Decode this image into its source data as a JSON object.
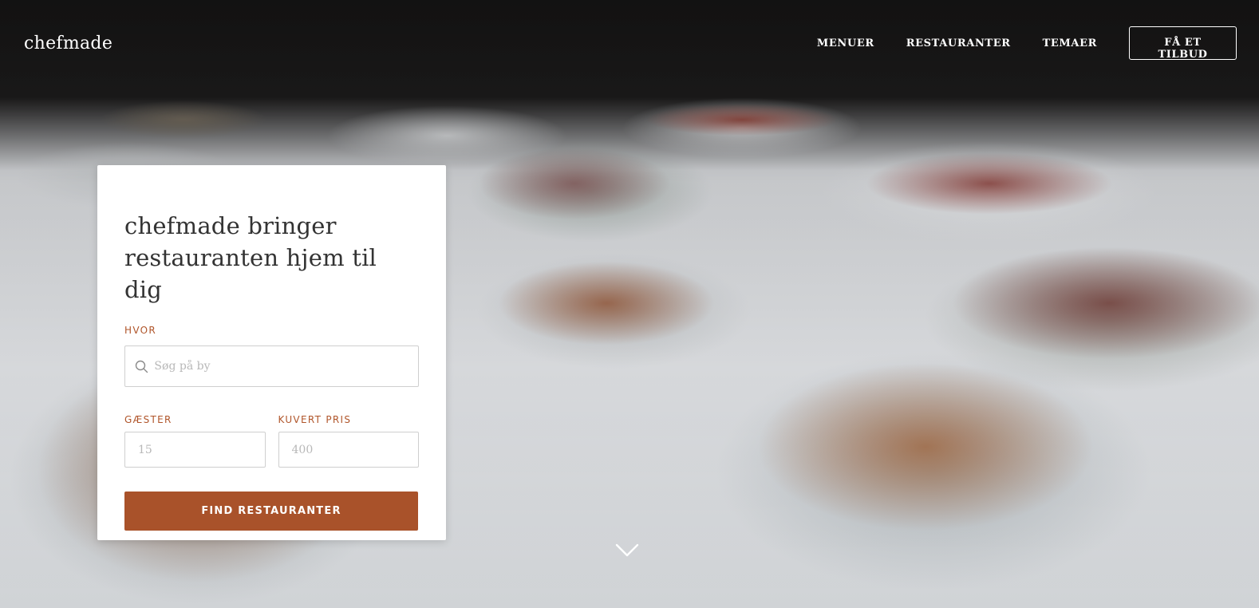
{
  "header": {
    "logo": "chefmade",
    "nav": [
      {
        "label": "MENUER"
      },
      {
        "label": "RESTAURANTER"
      },
      {
        "label": "TEMAER"
      }
    ],
    "cta_label": "FÅ ET TILBUD"
  },
  "search_card": {
    "title_line1": "chefmade bringer",
    "title_line2": "restauranten hjem til dig",
    "where_label": "HVOR",
    "where_placeholder": "Søg på by",
    "guests_label": "GÆSTER",
    "guests_placeholder": "15",
    "price_label": "KUVERT PRIS",
    "price_placeholder": "400",
    "submit_label": "FIND RESTAURANTER"
  },
  "colors": {
    "accent": "#a9522a",
    "label": "#b0552a",
    "text": "#333333"
  },
  "icons": {
    "search": "search-icon",
    "scroll": "chevron-down-icon"
  }
}
